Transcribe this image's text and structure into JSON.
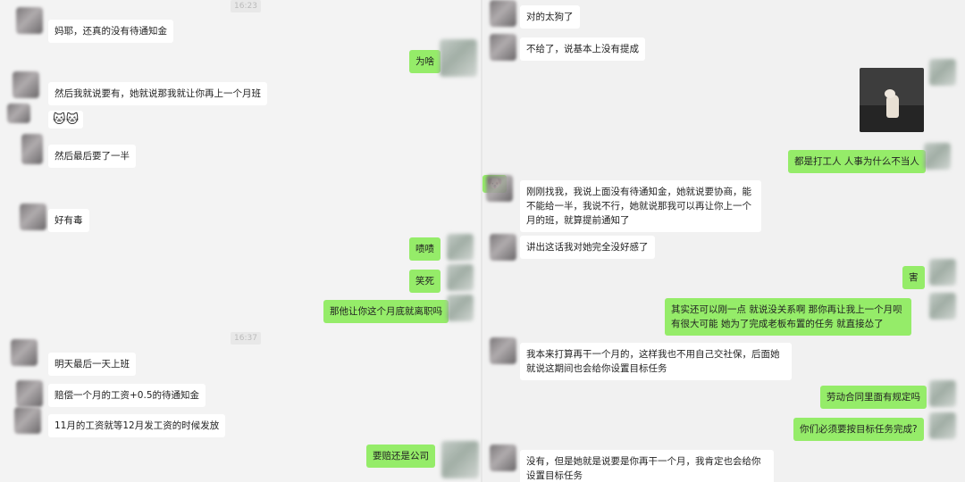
{
  "left_chat": {
    "timestamps": [
      "16:23",
      "16:37"
    ],
    "messages": [
      {
        "sender": "other",
        "text": "妈耶，还真的没有待通知金"
      },
      {
        "sender": "me",
        "text": "为啥"
      },
      {
        "sender": "other",
        "text": "然后我就说要有，她就说那我就让你再上一个月班"
      },
      {
        "sender": "other",
        "text": "🐱🐱"
      },
      {
        "sender": "other",
        "text": "然后最后要了一半"
      },
      {
        "sender": "other",
        "text": "好有毒"
      },
      {
        "sender": "me",
        "text": "啧啧"
      },
      {
        "sender": "me",
        "text": "笑死"
      },
      {
        "sender": "me",
        "text": "那他让你这个月底就离职吗"
      },
      {
        "sender": "other",
        "text": "明天最后一天上班"
      },
      {
        "sender": "other",
        "text": "赔偿一个月的工资+0.5的待通知金"
      },
      {
        "sender": "other",
        "text": "11月的工资就等12月发工资的时候发放"
      },
      {
        "sender": "me",
        "text": "要赔还是公司"
      }
    ]
  },
  "right_chat": {
    "messages": [
      {
        "sender": "other",
        "text": "对的太狗了"
      },
      {
        "sender": "other",
        "text": "不给了，说基本上没有提成"
      },
      {
        "sender": "me",
        "text": "都是打工人  人事为什么不当人"
      },
      {
        "sender": "me",
        "text": "🐶"
      },
      {
        "sender": "other",
        "text": "刚刚找我，我说上面没有待通知金，她就说要协商，能不能给一半，我说不行，她就说那我可以再让你上一个月的班，就算提前通知了"
      },
      {
        "sender": "other",
        "text": "讲出这话我对她完全没好感了"
      },
      {
        "sender": "me",
        "text": "害"
      },
      {
        "sender": "me",
        "text": "其实还可以刚一点  就说没关系啊  那你再让我上一个月呗    有很大可能  她为了完成老板布置的任务   就直接怂了"
      },
      {
        "sender": "other",
        "text": "我本来打算再干一个月的，这样我也不用自己交社保，后面她就说这期间也会给你设置目标任务"
      },
      {
        "sender": "me",
        "text": "劳动合同里面有规定吗"
      },
      {
        "sender": "me",
        "text": "你们必须要按目标任务完成?"
      },
      {
        "sender": "other",
        "text": "没有，但是她就是说要是你再干一个月，我肯定也会给你设置目标任务"
      }
    ]
  }
}
